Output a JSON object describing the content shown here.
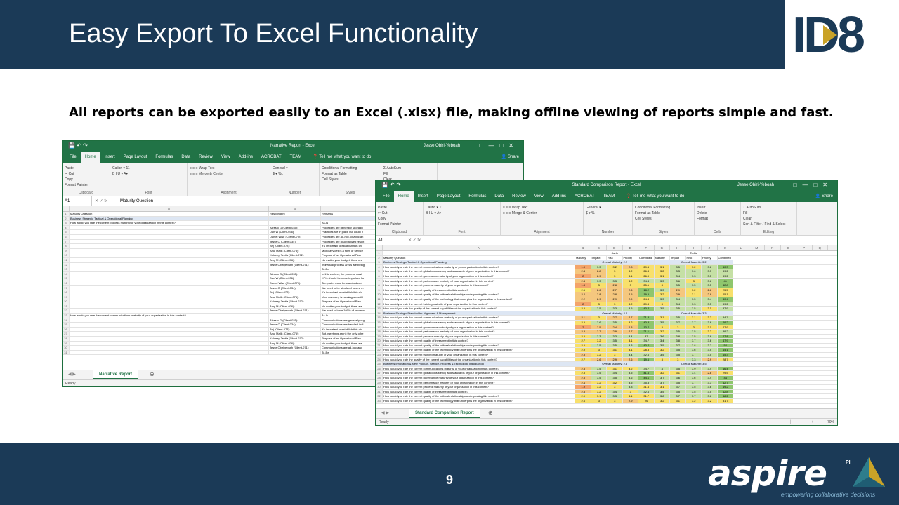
{
  "slide": {
    "title": "Easy Export To Excel Functionality",
    "subtitle": "All reports can be exported easily to an Excel (.xlsx) file, making offline viewing of reports simple and fast.",
    "page_number": "9",
    "colors": {
      "header": "#1b3a57",
      "excel_green": "#217346"
    }
  },
  "logos": {
    "id8": "ID8",
    "aspire": "aspire",
    "aspire_sup": "PI",
    "aspire_tagline": "empowering collaborative decisions"
  },
  "excel_common": {
    "tabs": [
      "File",
      "Home",
      "Insert",
      "Page Layout",
      "Formulas",
      "Data",
      "Review",
      "View",
      "Add-ins",
      "ACROBAT",
      "TEAM"
    ],
    "tell_me": "Tell me what you want to do",
    "share": "Share",
    "user": "Jesse Obiri-Yeboah",
    "cell_ref": "A1",
    "status": "Ready",
    "groups": {
      "clipboard": "Clipboard",
      "font": "Font",
      "alignment": "Alignment",
      "number": "Number",
      "styles": "Styles",
      "cells": "Cells",
      "editing": "Editing"
    },
    "buttons": {
      "paste": "Paste",
      "cut": "Cut",
      "copy": "Copy",
      "format_painter": "Format Painter",
      "font_name": "Calibri",
      "font_size": "11",
      "wrap_text": "Wrap Text",
      "merge_center": "Merge & Center",
      "number_format": "General",
      "conditional": "Conditional Formatting",
      "format_table": "Format as Table",
      "cell_styles": "Cell Styles",
      "insert": "Insert",
      "delete": "Delete",
      "format": "Format",
      "autosum": "AutoSum",
      "fill": "Fill",
      "clear": "Clear",
      "sort_filter": "Sort & Filter",
      "find_select": "Find & Select"
    }
  },
  "narrative": {
    "window_title": "Narrative Report - Excel",
    "formula_value": "Maturity Question",
    "sheet_tab": "Narrative Report",
    "col_headers": [
      "A",
      "B"
    ],
    "header_row": [
      "Maturity Question",
      "Respondent",
      "Remarks"
    ],
    "rows": [
      [
        "Business Strategic Tactical & Operational Planning",
        "",
        ""
      ],
      [
        "How would you rate the current process maturity of your organization in this context?",
        "",
        "As-Is"
      ],
      [
        "",
        "Alessio G (Client-035):",
        "Processes are generally sporadic"
      ],
      [
        "",
        "Dan W (Client-036):",
        "Practices are in place but could b"
      ],
      [
        "",
        "Daniel Wise (Client-070):",
        "Processes are ad-hoc, chaotic an"
      ],
      [
        "",
        "Jesse O (Client-034):",
        "Processes are disorganized result"
      ],
      [
        "",
        "Brij (Client-073):",
        "It's important to establish this ch"
      ],
      [
        "",
        "Anuj Malik (Client-075):",
        "Microservices is a form of service"
      ],
      [
        "",
        "Kuldeep Tevtia (Client-072):",
        "Purpose of an Operational Plan"
      ],
      [
        "",
        "Amy M (Client-076):",
        "No matter your budget, there are"
      ],
      [
        "",
        "Jesse Obiriyeboah (Client-071):",
        "Individual process areas are being"
      ],
      [
        "",
        "",
        "To-Be"
      ],
      [
        "",
        "Alessio G (Client-035):",
        "In this context, the process must"
      ],
      [
        "",
        "Dan W (Client-036):",
        "KPIs should be more important for"
      ],
      [
        "",
        "Daniel Wise (Client-070):",
        "Templates must be standardized"
      ],
      [
        "",
        "Jesse O (Client-034):",
        "We need to be at a level where m"
      ],
      [
        "",
        "Brij (Client-073):",
        "It's important to establish this ch"
      ],
      [
        "",
        "Anuj Malik (Client-075):",
        "Your company is running smoothl"
      ],
      [
        "",
        "Kuldeep Tevtia (Client-072):",
        "Purpose of an Operational Plan"
      ],
      [
        "",
        "Amy M (Client-076):",
        "No matter your budget, there are"
      ],
      [
        "",
        "Jesse Obiriyeboah (Client-071):",
        "We need to have 100% of process"
      ],
      [
        "How would you rate the current communications maturity of your organization in this context?",
        "",
        "As-Is"
      ],
      [
        "",
        "Alessio G (Client-035):",
        "Communications are generally org"
      ],
      [
        "",
        "Jesse O (Client-034):",
        "Communications are handled indi"
      ],
      [
        "",
        "Brij (Client-073):",
        "It's important to establish this ch"
      ],
      [
        "",
        "Anuj Malik (Client-075):",
        "But, meetings aren't the only othe"
      ],
      [
        "",
        "Kuldeep Tevtia (Client-072):",
        "Purpose of an Operational Plan"
      ],
      [
        "",
        "Amy M (Client-076):",
        "No matter your budget, there are"
      ],
      [
        "",
        "Jesse Obiriyeboah (Client-071):",
        "Communications are ad-hoc and"
      ],
      [
        "",
        "",
        "To-Be"
      ]
    ]
  },
  "comparison": {
    "window_title": "Standard Comparison Report - Excel",
    "formula_value": "",
    "sheet_tab": "Standard Comparison Report",
    "zoom": "70%",
    "col_headers": [
      "A",
      "B",
      "C",
      "D",
      "E",
      "F",
      "G",
      "H",
      "I",
      "J",
      "K",
      "L",
      "M",
      "N",
      "O",
      "P",
      "Q"
    ],
    "group_headers": [
      "As-Is",
      "To-Be"
    ],
    "metric_headers": [
      "Maturity Question",
      "Maturity",
      "Impact",
      "Risk",
      "Priority",
      "Combined",
      "Maturity",
      "Impact",
      "Risk",
      "Priority",
      "Combined"
    ],
    "rows": [
      {
        "q": "Business Strategic Tactical & Operational Planning",
        "section": true,
        "asis": "Overall Maturity: 2.2",
        "tobe": "Overall Maturity: 3.2"
      },
      {
        "q": "How would you rate the current communications maturity of your organization in this context?",
        "v": [
          "1.9",
          "3.3",
          "3.2",
          "2.8",
          "29.5",
          "3.1",
          "3.5",
          "3.2",
          "3.6",
          "40.3"
        ]
      },
      {
        "q": "How would you rate the current global consistency and standards of your organization in this context?",
        "v": [
          "2.4",
          "2.8",
          "3",
          "3.2",
          "26.8",
          "3.2",
          "3.3",
          "3.6",
          "3.3",
          "39.2"
        ]
      },
      {
        "q": "How would you rate the current governance maturity of your organization in this context?",
        "v": [
          "2",
          "2.9",
          "3",
          "3.1",
          "26.9",
          "3.1",
          "3.4",
          "3.3",
          "3.5",
          "39.2"
        ]
      },
      {
        "q": "How would you rate the current performance maturity of your organization in this context?",
        "v": [
          "2.4",
          "3.3",
          "3.3",
          "3.2",
          "34.8",
          "3.3",
          "3.6",
          "3",
          "3.6",
          "41"
        ]
      },
      {
        "q": "How would you rate the current process maturity of your organization in this context?",
        "v": [
          "1.8",
          "3",
          "2.8",
          "3",
          "25.1",
          "3",
          "3.5",
          "3.5",
          "3.5",
          "42.8"
        ]
      },
      {
        "q": "How would you rate the current quality of investment in this context?",
        "v": [
          "2.5",
          "2.6",
          "2.7",
          "2.6",
          "18.2",
          "3.3",
          "2.9",
          "3.2",
          "2.8",
          "25.5"
        ]
      },
      {
        "q": "How would you rate the current quality of the cultural relationships underpinning this context?",
        "v": [
          "2.2",
          "2.8",
          "2.8",
          "2.5",
          "19.5",
          "3.2",
          "2.9",
          "3.1",
          "2.8",
          "25.1"
        ]
      },
      {
        "q": "How would you rate the current quality of the technology that underpins the organization in this context?",
        "v": [
          "2.2",
          "2.9",
          "2.9",
          "2.9",
          "24.3",
          "3.3",
          "3.4",
          "3.5",
          "3.4",
          "40.4"
        ]
      },
      {
        "q": "How would you rate the current training maturity of your organization in this context?",
        "v": [
          "2",
          "3",
          "3",
          "3.2",
          "29.8",
          "3",
          "3.4",
          "3.3",
          "3.5",
          "39.2"
        ]
      },
      {
        "q": "How would you rate the quality of the current capabilities of the organization in this context?",
        "v": [
          "2.5",
          "3.5",
          "3.3",
          "3.5",
          "40.4",
          "3.5",
          "3.5",
          "3.5",
          "3.1",
          "37.9"
        ]
      },
      {
        "q": "Business Strategic Stakeholder Alignment & Management",
        "section": true,
        "asis": "Overall Maturity: 2.4",
        "tobe": "Overall Maturity: 3.3"
      },
      {
        "q": "How would you rate the current communications maturity of your organization in this context?",
        "v": [
          "2.1",
          "3",
          "2.7",
          "2.7",
          "21.8",
          "3.1",
          "3.5",
          "3.1",
          "3.2",
          "34.7"
        ]
      },
      {
        "q": "How would you rate the current global consistency and standards of your organization in this context?",
        "v": [
          "2.5",
          "3.6",
          "3.5",
          "3.2",
          "40.3",
          "3.5",
          "3.7",
          "3.7",
          "3.6",
          "49.2"
        ]
      },
      {
        "q": "How would you rate the current governance maturity of your organization in this context?",
        "v": [
          "2",
          "2.5",
          "2.4",
          "2.3",
          "13.7",
          "3",
          "3",
          "3",
          "3.1",
          "27.9"
        ]
      },
      {
        "q": "How would you rate the current performance maturity of your organization in this context?",
        "v": [
          "2.3",
          "2.7",
          "2.9",
          "2.7",
          "21.1",
          "3.2",
          "3.5",
          "3.5",
          "3.2",
          "39.2"
        ]
      },
      {
        "q": "How would you rate the current process maturity of your organization in this context?",
        "v": [
          "2.5",
          "3.3",
          "3.3",
          "3.4",
          "37",
          "3.6",
          "3.8",
          "3.5",
          "3.6",
          "47.8"
        ]
      },
      {
        "q": "How would you rate the current quality of investment in this context?",
        "v": [
          "2.7",
          "3.2",
          "3.5",
          "3.1",
          "34.7",
          "3.4",
          "3.8",
          "3.7",
          "3.6",
          "47.9"
        ]
      },
      {
        "q": "How would you rate the current quality of the cultural relationships underpinning this context?",
        "v": [
          "2.5",
          "3.5",
          "3.5",
          "3.3",
          "40.4",
          "3.5",
          "3.7",
          "3.8",
          "3.7",
          "52"
        ]
      },
      {
        "q": "How would you rate the current quality of the technology that underpins the organization in this context?",
        "v": [
          "2.9",
          "3",
          "3.1",
          "3.1",
          "28.8",
          "3.2",
          "3.5",
          "3.6",
          "3.5",
          "44.1"
        ]
      },
      {
        "q": "How would you rate the current training maturity of your organization in this context?",
        "v": [
          "2.3",
          "3.2",
          "3",
          "3.4",
          "32.6",
          "3.5",
          "3.5",
          "3.7",
          "3.5",
          "45.3"
        ]
      },
      {
        "q": "How would you rate the quality of the current capabilities of the organization in this context?",
        "v": [
          "2.7",
          "2.6",
          "2.9",
          "2.6",
          "19.6",
          "3",
          "3",
          "3.3",
          "2.9",
          "28.7"
        ]
      },
      {
        "q": "Business Innovation & New Product, Service, Process & Technology Introduction",
        "section": true,
        "asis": "Overall Maturity: 2.5",
        "tobe": "Overall Maturity: 3.5"
      },
      {
        "q": "How would you rate the current communications maturity of your organization in this context?",
        "v": [
          "2.3",
          "3.5",
          "3.1",
          "3.2",
          "34.7",
          "4",
          "3.5",
          "3.9",
          "3.4",
          "46.4"
        ]
      },
      {
        "q": "How would you rate the current global consistency and standards of your organization in this context?",
        "v": [
          "2.5",
          "3.5",
          "3.4",
          "3.5",
          "41.6",
          "3.2",
          "3.1",
          "3.4",
          "2.8",
          "29.5"
        ]
      },
      {
        "q": "How would you rate the current governance maturity of your organization in this context?",
        "v": [
          "2.3",
          "3.5",
          "3.5",
          "3.6",
          "44.1",
          "3.7",
          "3.6",
          "3.6",
          "3.4",
          "44"
        ]
      },
      {
        "q": "How would you rate the current performance maturity of your organization in this context?",
        "v": [
          "2.4",
          "3.2",
          "3.2",
          "3.5",
          "35.8",
          "3.7",
          "3.5",
          "3.7",
          "3.3",
          "42.7"
        ]
      },
      {
        "q": "How would you rate the current process maturity of your organization in this context?",
        "v": [
          "1.9",
          "3.2",
          "3",
          "3.3",
          "31.6",
          "3.1",
          "3.7",
          "3.5",
          "3.6",
          "49.2"
        ]
      },
      {
        "q": "How would you rate the current quality of investment in this context?",
        "v": [
          "2.3",
          "3.2",
          "3.4",
          "3",
          "32.6",
          "3.5",
          "3.5",
          "3.5",
          "3.5",
          "42.8"
        ]
      },
      {
        "q": "How would you rate the current quality of the cultural relationships underpinning this context?",
        "v": [
          "2.9",
          "3.1",
          "3.3",
          "3.1",
          "31.7",
          "3.8",
          "3.7",
          "3.7",
          "3.6",
          "48.2"
        ]
      },
      {
        "q": "How would you rate the current quality of the technology that underpins the organization in this context?",
        "v": [
          "2.6",
          "3",
          "3",
          "2.9",
          "26",
          "3.2",
          "3.1",
          "3.2",
          "3.2",
          "31.7"
        ]
      }
    ]
  }
}
